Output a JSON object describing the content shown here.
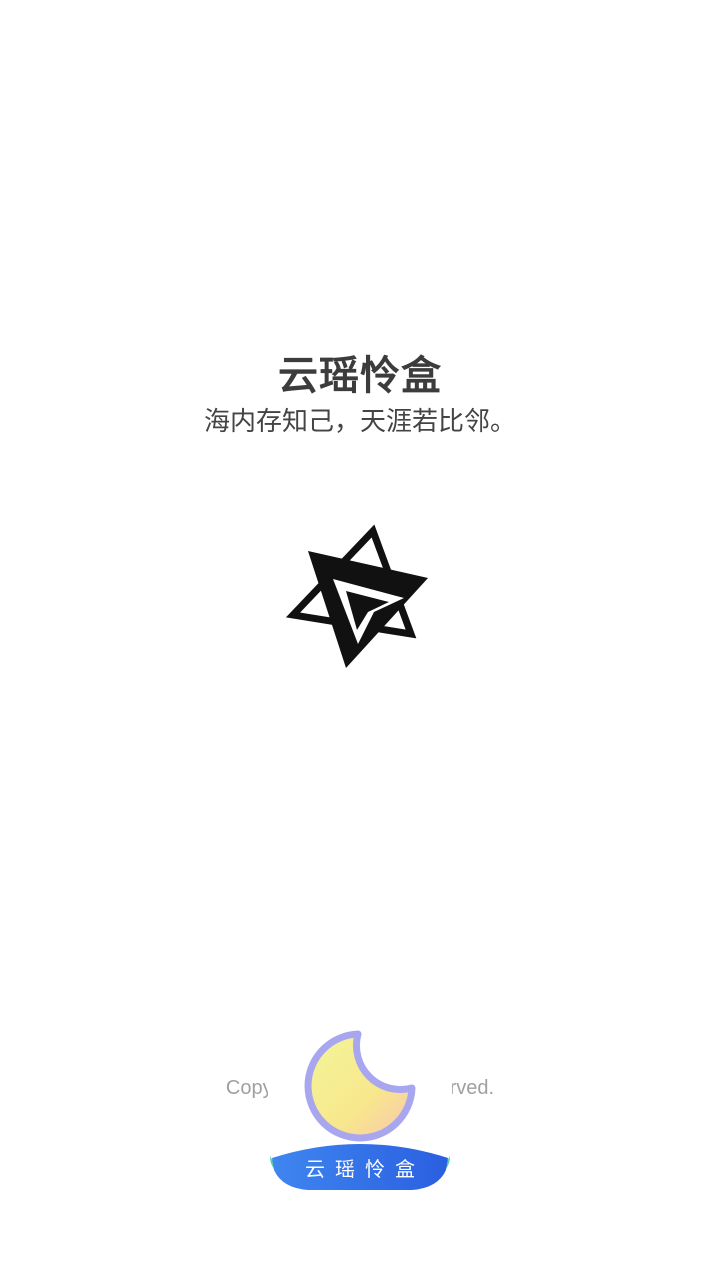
{
  "splash": {
    "app_name": "云瑶怜盒",
    "slogan": "海内存知己，天涯若比邻。",
    "copyright": "Copyright @ 2                          ghts Reserved.",
    "badge_label": "云瑶怜盒"
  },
  "icons": {
    "center_logo": "star-arrow-logo-icon",
    "badge_logo": "crescent-moon-icon"
  },
  "colors": {
    "background": "#ffffff",
    "title": "#3c3c3c",
    "copyright": "#a0a0a0",
    "badge_blue": "#2f6fe8",
    "badge_green": "#4fd29a",
    "moon_fill": "#f7ea8a",
    "moon_outline": "#a9a6f0"
  }
}
